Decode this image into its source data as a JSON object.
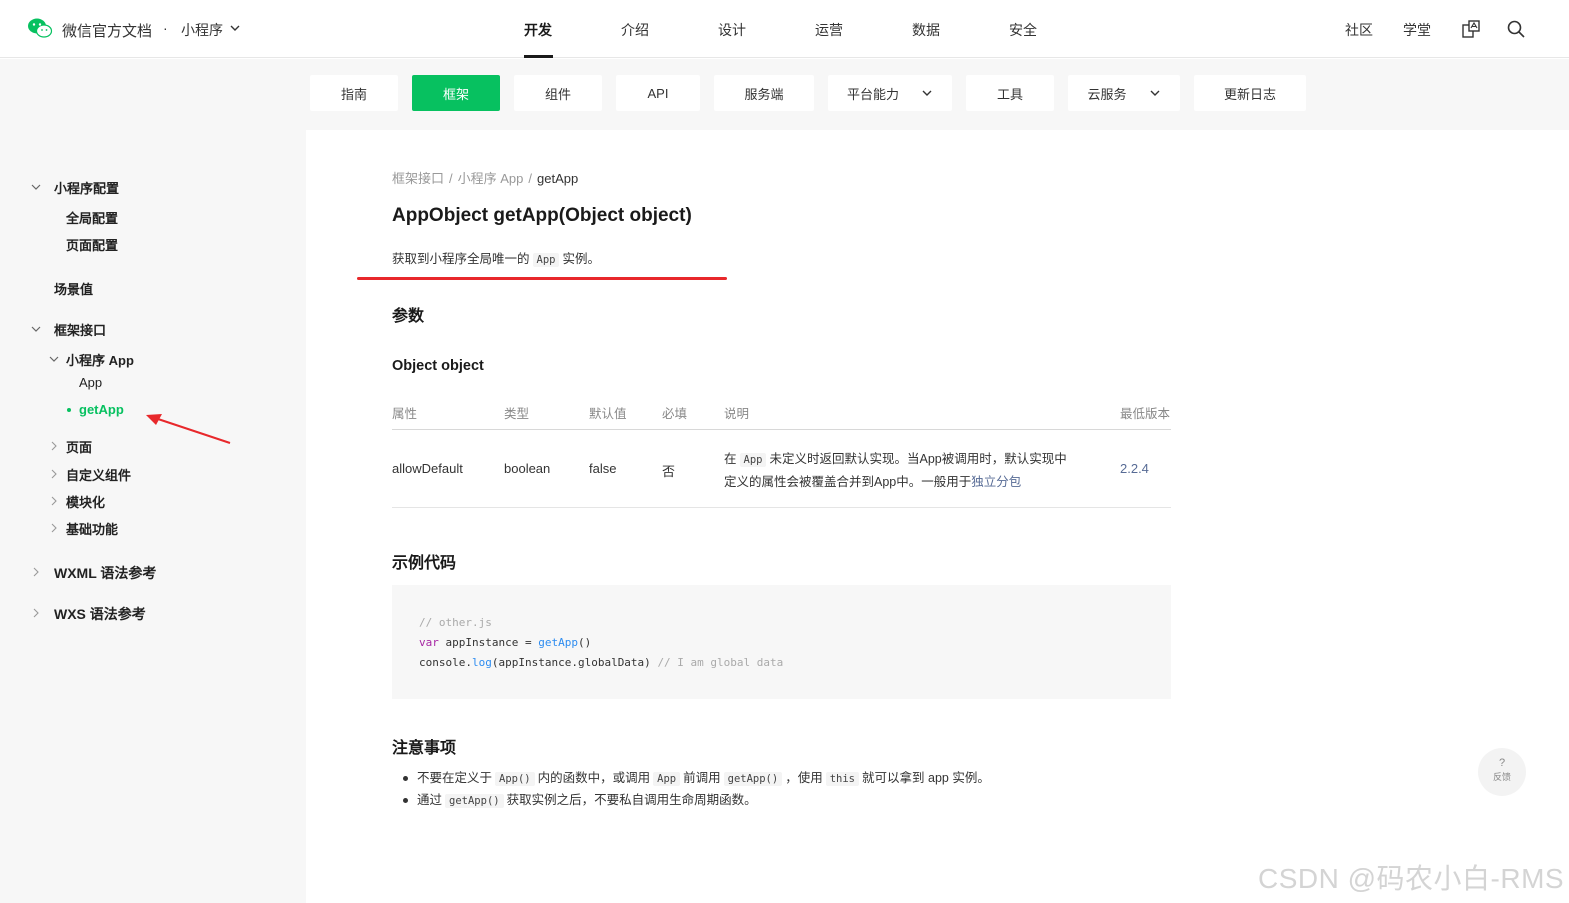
{
  "header": {
    "brand": "微信官方文档",
    "separator": "·",
    "product": "小程序",
    "main_nav": [
      "开发",
      "介绍",
      "设计",
      "运营",
      "数据",
      "安全"
    ],
    "active_nav": "开发",
    "right_nav": [
      "社区",
      "学堂"
    ]
  },
  "subnav": {
    "tabs": [
      {
        "label": "指南"
      },
      {
        "label": "框架",
        "active": true
      },
      {
        "label": "组件"
      },
      {
        "label": "API"
      },
      {
        "label": "服务端"
      },
      {
        "label": "平台能力",
        "dropdown": true
      },
      {
        "label": "工具"
      },
      {
        "label": "云服务",
        "dropdown": true
      },
      {
        "label": "更新日志"
      }
    ]
  },
  "sidebar": {
    "items": [
      {
        "label": "小程序配置"
      },
      {
        "label": "全局配置"
      },
      {
        "label": "页面配置"
      },
      {
        "label": "场景值"
      },
      {
        "label": "框架接口"
      },
      {
        "label": "小程序 App"
      },
      {
        "label": "App"
      },
      {
        "label": "getApp",
        "active": true
      },
      {
        "label": "页面"
      },
      {
        "label": "自定义组件"
      },
      {
        "label": "模块化"
      },
      {
        "label": "基础功能"
      },
      {
        "label": "WXML 语法参考"
      },
      {
        "label": "WXS 语法参考"
      }
    ]
  },
  "content": {
    "breadcrumb": [
      "框架接口",
      "小程序 App",
      "getApp"
    ],
    "title": "AppObject getApp(Object object)",
    "description": {
      "before": "获取到小程序全局唯一的",
      "code": "App",
      "after": "实例。"
    },
    "params_heading": "参数",
    "object_heading": "Object object",
    "table": {
      "headers": [
        "属性",
        "类型",
        "默认值",
        "必填",
        "说明",
        "最低版本"
      ],
      "row": {
        "name": "allowDefault",
        "type": "boolean",
        "default": "false",
        "required": "否",
        "desc_prefix": "在",
        "desc_code": "App",
        "desc_line1": "未定义时返回默认实现。当App被调用时，默认实现中",
        "desc_line2": "定义的属性会被覆盖合并到App中。一般用于",
        "desc_link": "独立分包",
        "version": "2.2.4"
      }
    },
    "example_heading": "示例代码",
    "code": {
      "comment": "// other.js",
      "line2_kw": "var",
      "line2_mid": " appInstance = ",
      "line2_fn": "getApp",
      "line2_end": "()",
      "line3_a": "console.",
      "line3_fn": "log",
      "line3_b": "(appInstance.globalData) ",
      "line3_comment": "// I am global data"
    },
    "notes_heading": "注意事项",
    "notes": [
      {
        "p1": "不要在定义于",
        "c1": "App()",
        "p2": "内的函数中，或调用",
        "c2": "App",
        "p3": "前调用",
        "c3": "getApp()",
        "p4": "，使用",
        "c4": "this",
        "p5": "就可以拿到 app 实例。"
      },
      {
        "p1": "通过",
        "c1": "getApp()",
        "p2": "获取实例之后，不要私自调用生命周期函数。"
      }
    ]
  },
  "feedback": {
    "symbol": "?",
    "label": "反馈"
  },
  "watermark": "CSDN @码农小白-RMS",
  "colors": {
    "accent": "#07c160",
    "annotation": "#e8282b",
    "link": "#576b95"
  }
}
